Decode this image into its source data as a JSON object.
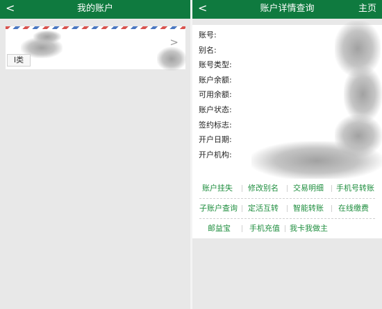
{
  "left": {
    "header": {
      "back": "<",
      "title": "我的账户"
    },
    "card": {
      "chevron": ">",
      "tag": "I类"
    }
  },
  "right": {
    "header": {
      "back": "<",
      "title": "账户详情查询",
      "home": "主页"
    },
    "fields": [
      "账号:",
      "别名:",
      "账号类型:",
      "账户余额:",
      "可用余额:",
      "账户状态:",
      "签约标志:",
      "开户日期:",
      "开户机构:"
    ],
    "actions": [
      [
        "账户挂失",
        "修改别名",
        "交易明细",
        "手机号转账"
      ],
      [
        "子账户查询",
        "定活互转",
        "智能转账",
        "在线缴费"
      ],
      [
        "邮益宝",
        "手机充值",
        "我卡我做主"
      ]
    ]
  },
  "colors": {
    "header_green": "#0f7a3f",
    "action_green": "#1f8e3f"
  }
}
